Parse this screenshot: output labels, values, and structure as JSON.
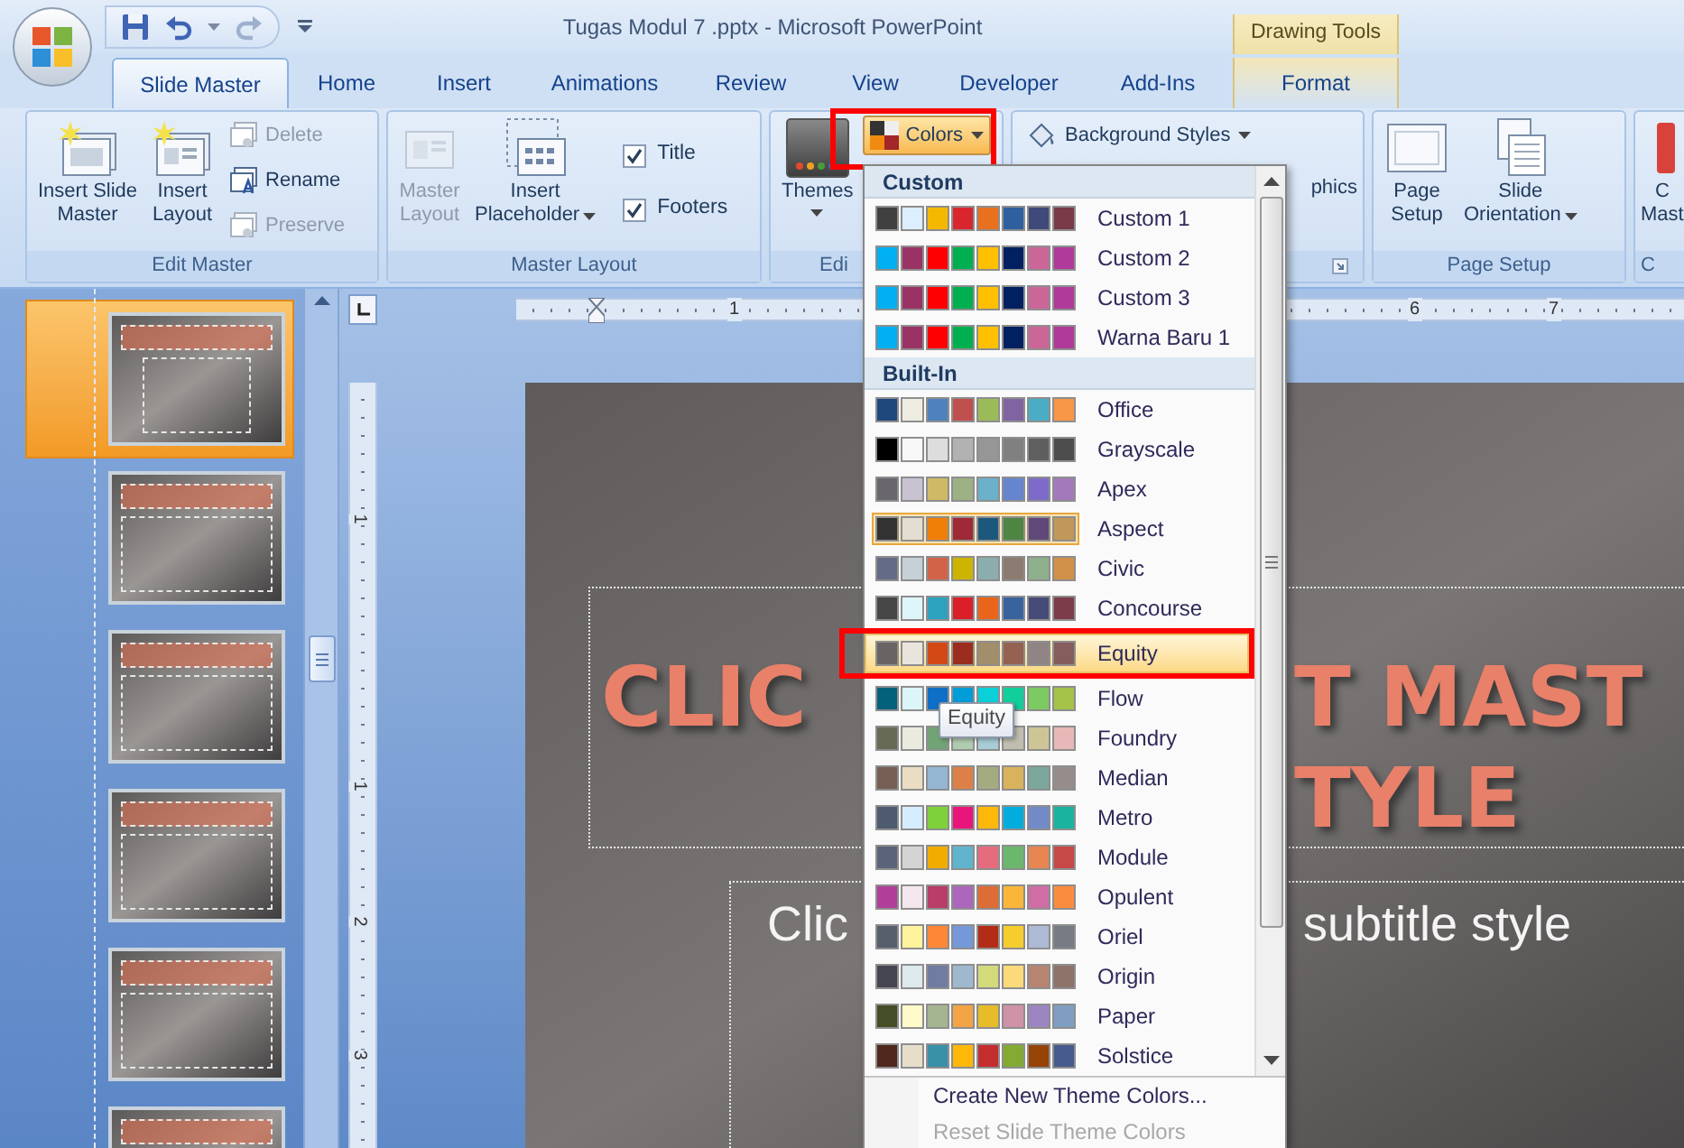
{
  "window": {
    "title": "Tugas Modul 7 .pptx - Microsoft PowerPoint",
    "context_group": "Drawing Tools"
  },
  "tabs": [
    {
      "label": "Slide Master",
      "selected": true,
      "contextual": false
    },
    {
      "label": "Home",
      "selected": false,
      "contextual": false
    },
    {
      "label": "Insert",
      "selected": false,
      "contextual": false
    },
    {
      "label": "Animations",
      "selected": false,
      "contextual": false
    },
    {
      "label": "Review",
      "selected": false,
      "contextual": false
    },
    {
      "label": "View",
      "selected": false,
      "contextual": false
    },
    {
      "label": "Developer",
      "selected": false,
      "contextual": false
    },
    {
      "label": "Add-Ins",
      "selected": false,
      "contextual": false
    },
    {
      "label": "Format",
      "selected": false,
      "contextual": true
    }
  ],
  "ribbon_groups": [
    {
      "label": "Edit Master",
      "items": [
        {
          "kind": "large",
          "lines": [
            "Insert Slide",
            "Master"
          ],
          "disabled": false
        },
        {
          "kind": "large",
          "lines": [
            "Insert",
            "Layout"
          ],
          "disabled": false
        },
        {
          "kind": "small",
          "label": "Delete",
          "disabled": true
        },
        {
          "kind": "small",
          "label": "Rename",
          "disabled": false
        },
        {
          "kind": "small",
          "label": "Preserve",
          "disabled": true
        }
      ]
    },
    {
      "label": "Master Layout",
      "items": [
        {
          "kind": "large",
          "lines": [
            "Master",
            "Layout"
          ],
          "disabled": true
        },
        {
          "kind": "large",
          "lines": [
            "Insert",
            "Placeholder"
          ],
          "disabled": false,
          "dropdown": true
        },
        {
          "kind": "check",
          "label": "Title",
          "checked": true
        },
        {
          "kind": "check",
          "label": "Footers",
          "checked": true
        }
      ]
    },
    {
      "label": "Edi",
      "items": [
        {
          "kind": "large",
          "lines": [
            "Themes"
          ],
          "disabled": false,
          "dropdown": true
        },
        {
          "kind": "small",
          "label": "Colors",
          "disabled": false,
          "dropdown": true,
          "pressed": true,
          "annotated": true
        }
      ]
    },
    {
      "launcher": true,
      "items": [
        {
          "kind": "small",
          "label": "Background Styles",
          "disabled": false,
          "dropdown": true
        },
        {
          "kind": "fragment",
          "label": "phics"
        }
      ]
    },
    {
      "label": "Page Setup",
      "items": [
        {
          "kind": "large",
          "lines": [
            "Page",
            "Setup"
          ],
          "disabled": false
        },
        {
          "kind": "large",
          "lines": [
            "Slide",
            "Orientation"
          ],
          "disabled": false,
          "dropdown": true
        }
      ]
    },
    {
      "label": "C",
      "items": [
        {
          "kind": "large",
          "lines": [
            "C",
            "Mast"
          ],
          "disabled": false
        }
      ]
    }
  ],
  "thumbnails": [
    {
      "selected": true
    },
    {
      "selected": false
    },
    {
      "selected": false
    },
    {
      "selected": false
    },
    {
      "selected": false
    },
    {
      "selected": false
    }
  ],
  "horizontal_ruler": {
    "numbers": [
      "1",
      "6",
      "7"
    ]
  },
  "vertical_ruler": {
    "numbers": [
      "1",
      "1",
      "2",
      "3"
    ]
  },
  "slide": {
    "title_parts": [
      "CLIC",
      "T MAST",
      "TYLE"
    ],
    "subtitle_parts": [
      "Clic",
      "subtitle style"
    ]
  },
  "colors_menu": {
    "sections": [
      {
        "heading": "Custom",
        "items": [
          {
            "label": "Custom 1",
            "selected": false,
            "current": false,
            "annotated": false,
            "swatches": [
              {
                "color": "#404040"
              },
              {
                "color": "#ddeeff"
              },
              {
                "color": "#f5b800"
              },
              {
                "color": "#d9262e"
              },
              {
                "color": "#e8701e"
              },
              {
                "color": "#2e5f9e"
              },
              {
                "color": "#3f4a7a"
              },
              {
                "color": "#7a3a48"
              }
            ]
          },
          {
            "label": "Custom 2",
            "selected": false,
            "current": false,
            "annotated": false,
            "swatches": [
              {
                "color": "#00b0f0"
              },
              {
                "color": "#993366"
              },
              {
                "color": "#ff0000"
              },
              {
                "color": "#00b050"
              },
              {
                "color": "#ffc000"
              },
              {
                "color": "#002060"
              },
              {
                "color": "#cc6699"
              },
              {
                "color": "#b03a9a"
              }
            ]
          },
          {
            "label": "Custom 3",
            "selected": false,
            "current": false,
            "annotated": false,
            "swatches": [
              {
                "color": "#00b0f0"
              },
              {
                "color": "#993366"
              },
              {
                "color": "#ff0000"
              },
              {
                "color": "#00b050"
              },
              {
                "color": "#ffc000"
              },
              {
                "color": "#002060"
              },
              {
                "color": "#cc6699"
              },
              {
                "color": "#b03a9a"
              }
            ]
          },
          {
            "label": "Warna Baru 1",
            "selected": false,
            "current": false,
            "annotated": false,
            "swatches": [
              {
                "color": "#00b0f0"
              },
              {
                "color": "#993366"
              },
              {
                "color": "#ff0000"
              },
              {
                "color": "#00b050"
              },
              {
                "color": "#ffc000"
              },
              {
                "color": "#002060"
              },
              {
                "color": "#cc6699"
              },
              {
                "color": "#b03a9a"
              }
            ]
          }
        ]
      },
      {
        "heading": "Built-In",
        "items": [
          {
            "label": "Office",
            "selected": false,
            "current": false,
            "annotated": false,
            "swatches": [
              {
                "color": "#1f497d"
              },
              {
                "color": "#eeece1"
              },
              {
                "color": "#4f81bd"
              },
              {
                "color": "#c0504d"
              },
              {
                "color": "#9bbb59"
              },
              {
                "color": "#8064a2"
              },
              {
                "color": "#4bacc6"
              },
              {
                "color": "#f79646"
              }
            ]
          },
          {
            "label": "Grayscale",
            "selected": false,
            "current": false,
            "annotated": false,
            "swatches": [
              {
                "color": "#000000"
              },
              {
                "color": "#f8f8f8"
              },
              {
                "color": "#dddddd"
              },
              {
                "color": "#b2b2b2"
              },
              {
                "color": "#969696"
              },
              {
                "color": "#808080"
              },
              {
                "color": "#5f5f5f"
              },
              {
                "color": "#4d4d4d"
              }
            ]
          },
          {
            "label": "Apex",
            "selected": false,
            "current": false,
            "annotated": false,
            "swatches": [
              {
                "color": "#69676d"
              },
              {
                "color": "#c9c2d1"
              },
              {
                "color": "#ceb966"
              },
              {
                "color": "#9cb084"
              },
              {
                "color": "#6bb1c9"
              },
              {
                "color": "#6585cf"
              },
              {
                "color": "#7e6bc9"
              },
              {
                "color": "#a379bb"
              }
            ]
          },
          {
            "label": "Aspect",
            "selected": false,
            "current": true,
            "annotated": false,
            "swatches": [
              {
                "color": "#323232"
              },
              {
                "color": "#e3ded1"
              },
              {
                "color": "#f07f09"
              },
              {
                "color": "#9f2936"
              },
              {
                "color": "#1b587c"
              },
              {
                "color": "#4e8542"
              },
              {
                "color": "#604878"
              },
              {
                "color": "#c19859"
              }
            ]
          },
          {
            "label": "Civic",
            "selected": false,
            "current": false,
            "annotated": false,
            "swatches": [
              {
                "color": "#646b86"
              },
              {
                "color": "#c5d1d7"
              },
              {
                "color": "#d16349"
              },
              {
                "color": "#ccb400"
              },
              {
                "color": "#8cadae"
              },
              {
                "color": "#8c7b70"
              },
              {
                "color": "#8fb08c"
              },
              {
                "color": "#d19049"
              }
            ]
          },
          {
            "label": "Concourse",
            "selected": false,
            "current": false,
            "annotated": false,
            "swatches": [
              {
                "color": "#464646"
              },
              {
                "color": "#def5fa"
              },
              {
                "color": "#2da2bf"
              },
              {
                "color": "#da1f28"
              },
              {
                "color": "#eb641b"
              },
              {
                "color": "#39639d"
              },
              {
                "color": "#474b78"
              },
              {
                "color": "#7d3c4a"
              }
            ]
          },
          {
            "label": "Equity",
            "selected": true,
            "current": false,
            "annotated": true,
            "swatches": [
              {
                "color": "#696464"
              },
              {
                "color": "#e9e5dc"
              },
              {
                "color": "#d34817"
              },
              {
                "color": "#9b2d1f"
              },
              {
                "color": "#a28e6a"
              },
              {
                "color": "#956251"
              },
              {
                "color": "#918485"
              },
              {
                "color": "#855d5d"
              }
            ]
          },
          {
            "label": "Flow",
            "selected": false,
            "current": false,
            "annotated": false,
            "swatches": [
              {
                "color": "#04617b"
              },
              {
                "color": "#dbf5f9"
              },
              {
                "color": "#0f6fc6"
              },
              {
                "color": "#009dd9"
              },
              {
                "color": "#0bd0d9"
              },
              {
                "color": "#10cf9b"
              },
              {
                "color": "#7cca62"
              },
              {
                "color": "#a5c249"
              }
            ]
          },
          {
            "label": "Foundry",
            "selected": false,
            "current": false,
            "annotated": false,
            "swatches": [
              {
                "color": "#676a55"
              },
              {
                "color": "#eaebde"
              },
              {
                "color": "#72a376"
              },
              {
                "color": "#b0ccb0"
              },
              {
                "color": "#a8cdd7"
              },
              {
                "color": "#c0beaf"
              },
              {
                "color": "#cec597"
              },
              {
                "color": "#e8b7b7"
              }
            ]
          },
          {
            "label": "Median",
            "selected": false,
            "current": false,
            "annotated": false,
            "swatches": [
              {
                "color": "#775f55"
              },
              {
                "color": "#ebddc3"
              },
              {
                "color": "#94b6d2"
              },
              {
                "color": "#dd8047"
              },
              {
                "color": "#a5ab81"
              },
              {
                "color": "#d8b25c"
              },
              {
                "color": "#7ba79d"
              },
              {
                "color": "#968c8c"
              }
            ]
          },
          {
            "label": "Metro",
            "selected": false,
            "current": false,
            "annotated": false,
            "swatches": [
              {
                "color": "#4e5b6f"
              },
              {
                "color": "#d6ecff"
              },
              {
                "color": "#7fd13b"
              },
              {
                "color": "#ea157a"
              },
              {
                "color": "#feb80a"
              },
              {
                "color": "#00addc"
              },
              {
                "color": "#738ac8"
              },
              {
                "color": "#1ab39f"
              }
            ]
          },
          {
            "label": "Module",
            "selected": false,
            "current": false,
            "annotated": false,
            "swatches": [
              {
                "color": "#5a6378"
              },
              {
                "color": "#d4d4d4"
              },
              {
                "color": "#f0ad00"
              },
              {
                "color": "#60b5cc"
              },
              {
                "color": "#e66c7d"
              },
              {
                "color": "#6bb76d"
              },
              {
                "color": "#e88651"
              },
              {
                "color": "#c64847"
              }
            ]
          },
          {
            "label": "Opulent",
            "selected": false,
            "current": false,
            "annotated": false,
            "swatches": [
              {
                "color": "#b13f9a"
              },
              {
                "color": "#f4e7ed"
              },
              {
                "color": "#b83d68"
              },
              {
                "color": "#ac66bb"
              },
              {
                "color": "#de6c36"
              },
              {
                "color": "#f9b639"
              },
              {
                "color": "#cf6da4"
              },
              {
                "color": "#fa8d3d"
              }
            ]
          },
          {
            "label": "Oriel",
            "selected": false,
            "current": false,
            "annotated": false,
            "swatches": [
              {
                "color": "#575f6d"
              },
              {
                "color": "#fff39d"
              },
              {
                "color": "#fe8637"
              },
              {
                "color": "#7598d9"
              },
              {
                "color": "#b32c16"
              },
              {
                "color": "#f5cd2d"
              },
              {
                "color": "#aebad5"
              },
              {
                "color": "#777c84"
              }
            ]
          },
          {
            "label": "Origin",
            "selected": false,
            "current": false,
            "annotated": false,
            "swatches": [
              {
                "color": "#464653"
              },
              {
                "color": "#dde9ec"
              },
              {
                "color": "#727ca3"
              },
              {
                "color": "#9fb8cd"
              },
              {
                "color": "#d2da7a"
              },
              {
                "color": "#fada7a"
              },
              {
                "color": "#b88472"
              },
              {
                "color": "#8e736a"
              }
            ]
          },
          {
            "label": "Paper",
            "selected": false,
            "current": false,
            "annotated": false,
            "swatches": [
              {
                "color": "#444d26"
              },
              {
                "color": "#fefac9"
              },
              {
                "color": "#a5b592"
              },
              {
                "color": "#f3a447"
              },
              {
                "color": "#e7bc29"
              },
              {
                "color": "#d092a7"
              },
              {
                "color": "#9c85c0"
              },
              {
                "color": "#809ec2"
              }
            ]
          },
          {
            "label": "Solstice",
            "selected": false,
            "current": false,
            "annotated": false,
            "swatches": [
              {
                "color": "#4f271c"
              },
              {
                "color": "#e7dec9"
              },
              {
                "color": "#3891a7"
              },
              {
                "color": "#feb80a"
              },
              {
                "color": "#c32d2e"
              },
              {
                "color": "#84aa33"
              },
              {
                "color": "#964305"
              },
              {
                "color": "#475a8d"
              }
            ]
          }
        ]
      }
    ],
    "commands": [
      {
        "label": "Create New Theme Colors...",
        "disabled": false
      },
      {
        "label": "Reset Slide Theme Colors",
        "disabled": true
      }
    ],
    "tooltip": "Equity"
  }
}
